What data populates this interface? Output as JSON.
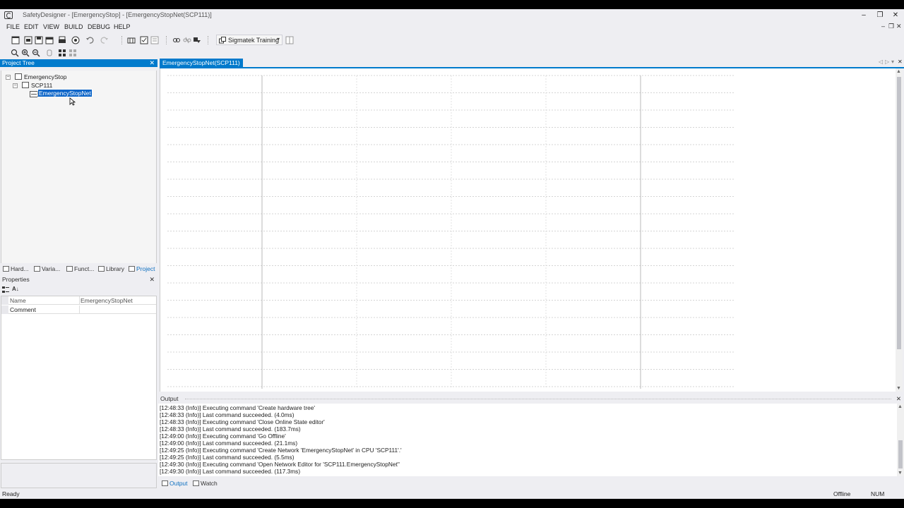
{
  "window": {
    "title": "SafetyDesigner - [EmergencyStop] - [EmergencyStopNet(SCP111)]",
    "minimize": "–",
    "restore": "❐",
    "close": "✕"
  },
  "menu": {
    "items": [
      "FILE",
      "EDIT",
      "VIEW",
      "BUILD",
      "DEBUG",
      "HELP"
    ],
    "mdi_minimize": "–",
    "mdi_restore": "❐",
    "mdi_close": "✕"
  },
  "toolbar": {
    "target_combo": "Sigmatek Training",
    "combo_arrow": "▾"
  },
  "project_tree": {
    "title": "Project Tree",
    "close": "✕",
    "nodes": [
      {
        "label": "EmergencyStop",
        "expander": "−"
      },
      {
        "label": "SCP111",
        "expander": "−"
      },
      {
        "label": "EmergencyStopNet"
      }
    ]
  },
  "left_tabs": [
    {
      "label": "Hard..."
    },
    {
      "label": "Varia..."
    },
    {
      "label": "Funct..."
    },
    {
      "label": "Library"
    },
    {
      "label": "Project"
    }
  ],
  "properties": {
    "title": "Properties",
    "close": "✕",
    "sort_icon": "A↓",
    "rows": [
      {
        "name": "Name",
        "value": "EmergencyStopNet"
      },
      {
        "name": "Comment",
        "value": ""
      }
    ]
  },
  "document": {
    "tab_label": "EmergencyStopNet(SCP111)",
    "nav_left": "◁",
    "nav_right": "▷",
    "nav_menu": "▾",
    "close": "✕"
  },
  "output": {
    "title": "Output",
    "close": "✕",
    "lines": [
      "[12:48:33 (Info)] Executing command 'Create hardware tree'",
      "[12:48:33 (Info)] Last command succeeded. (4.0ms)",
      "[12:48:33 (Info)] Executing command 'Close Online State editor'",
      "[12:48:33 (Info)] Last command succeeded. (183.7ms)",
      "[12:49:00 (Info)] Executing command 'Go Offline'",
      "[12:49:00 (Info)] Last command succeeded. (21.1ms)",
      "[12:49:25 (Info)] Executing command 'Create Network 'EmergencyStopNet' in CPU 'SCP111'.'",
      "[12:49:25 (Info)] Last command succeeded. (5.5ms)",
      "[12:49:30 (Info)] Executing command 'Open Network Editor for 'SCP111.EmergencyStopNet''",
      "[12:49:30 (Info)] Last command succeeded. (117.3ms)"
    ],
    "tabs": [
      "Output",
      "Watch"
    ]
  },
  "scroll": {
    "up": "▲",
    "down": "▼"
  },
  "status": {
    "left": "Ready",
    "mode": "Offline",
    "num": "NUM"
  }
}
